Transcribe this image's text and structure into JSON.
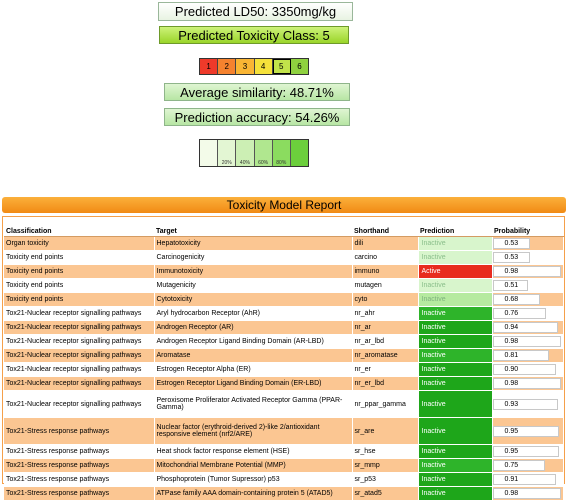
{
  "ld50": "Predicted LD50: 3350mg/kg",
  "toxicity_class": "Predicted Toxicity Class: 5",
  "class_scale": [
    {
      "label": "1",
      "color": "#ee3a2a"
    },
    {
      "label": "2",
      "color": "#f5822e"
    },
    {
      "label": "3",
      "color": "#f9b534"
    },
    {
      "label": "4",
      "color": "#f5e13a"
    },
    {
      "label": "5",
      "color": "#c2e34a"
    },
    {
      "label": "6",
      "color": "#8fd13f"
    }
  ],
  "average_similarity": "Average similarity: 48.71%",
  "prediction_accuracy": "Prediction accuracy: 54.26%",
  "accuracy_scale": [
    {
      "label": "",
      "color": "#f3fbe9"
    },
    {
      "label": "20%",
      "color": "#e3f6d3"
    },
    {
      "label": "40%",
      "color": "#ccefb4"
    },
    {
      "label": "60%",
      "color": "#b0e78f"
    },
    {
      "label": "80%",
      "color": "#8bdc5f"
    },
    {
      "label": "",
      "color": "#6ccf3c"
    }
  ],
  "report": {
    "title": "Toxicity Model Report",
    "headers": [
      "Classification",
      "Target",
      "Shorthand",
      "Prediction",
      "Probability"
    ],
    "rows": [
      {
        "classification": "Organ toxicity",
        "target": "Hepatotoxicity",
        "shorthand": "dili",
        "prediction": "Inactive",
        "probability": 0.53,
        "probability_text": "0.53",
        "pred_color": "#d8f5cc",
        "pred_text_color": "#8bbf8b"
      },
      {
        "classification": "Toxicity end points",
        "target": "Carcinogenicity",
        "shorthand": "carcino",
        "prediction": "Inactive",
        "probability": 0.53,
        "probability_text": "0.53",
        "pred_color": "#d8f5cc",
        "pred_text_color": "#8bbf8b"
      },
      {
        "classification": "Toxicity end points",
        "target": "Immunotoxicity",
        "shorthand": "immuno",
        "prediction": "Active",
        "probability": 0.98,
        "probability_text": "0.98",
        "pred_color": "#e82c1e",
        "pred_text_color": "#ffffff"
      },
      {
        "classification": "Toxicity end points",
        "target": "Mutagenicity",
        "shorthand": "mutagen",
        "prediction": "Inactive",
        "probability": 0.51,
        "probability_text": "0.51",
        "pred_color": "#d8f5cc",
        "pred_text_color": "#8bbf8b"
      },
      {
        "classification": "Toxicity end points",
        "target": "Cytotoxicity",
        "shorthand": "cyto",
        "prediction": "Inactive",
        "probability": 0.68,
        "probability_text": "0.68",
        "pred_color": "#b6eaa0",
        "pred_text_color": "#7fb37f"
      },
      {
        "classification": "Tox21-Nuclear receptor signalling pathways",
        "target": "Aryl hydrocarbon Receptor (AhR)",
        "shorthand": "nr_ahr",
        "prediction": "Inactive",
        "probability": 0.76,
        "probability_text": "0.76",
        "pred_color": "#2eb42a",
        "pred_text_color": "#ffffff"
      },
      {
        "classification": "Tox21-Nuclear receptor signalling pathways",
        "target": "Androgen Receptor (AR)",
        "shorthand": "nr_ar",
        "prediction": "Inactive",
        "probability": 0.94,
        "probability_text": "0.94",
        "pred_color": "#1ea61a",
        "pred_text_color": "#ffffff"
      },
      {
        "classification": "Tox21-Nuclear receptor signalling pathways",
        "target": "Androgen Receptor Ligand Binding Domain (AR-LBD)",
        "shorthand": "nr_ar_lbd",
        "prediction": "Inactive",
        "probability": 0.98,
        "probability_text": "0.98",
        "pred_color": "#1ea61a",
        "pred_text_color": "#ffffff"
      },
      {
        "classification": "Tox21-Nuclear receptor signalling pathways",
        "target": "Aromatase",
        "shorthand": "nr_aromatase",
        "prediction": "Inactive",
        "probability": 0.81,
        "probability_text": "0.81",
        "pred_color": "#2eb42a",
        "pred_text_color": "#ffffff"
      },
      {
        "classification": "Tox21-Nuclear receptor signalling pathways",
        "target": "Estrogen Receptor Alpha (ER)",
        "shorthand": "nr_er",
        "prediction": "Inactive",
        "probability": 0.9,
        "probability_text": "0.90",
        "pred_color": "#1ea61a",
        "pred_text_color": "#ffffff"
      },
      {
        "classification": "Tox21-Nuclear receptor signalling pathways",
        "target": "Estrogen Receptor Ligand Binding Domain (ER-LBD)",
        "shorthand": "nr_er_lbd",
        "prediction": "Inactive",
        "probability": 0.98,
        "probability_text": "0.98",
        "pred_color": "#1ea61a",
        "pred_text_color": "#ffffff"
      },
      {
        "classification": "Tox21-Nuclear receptor signalling pathways",
        "target": "Peroxisome Proliferator Activated Receptor Gamma (PPAR-Gamma)",
        "shorthand": "nr_ppar_gamma",
        "prediction": "Inactive",
        "probability": 0.93,
        "probability_text": "0.93",
        "pred_color": "#1ea61a",
        "pred_text_color": "#ffffff",
        "tall": true
      },
      {
        "classification": "Tox21-Stress response pathways",
        "target": "Nuclear factor (erythroid-derived 2)-like 2/antioxidant responsive element (nrf2/ARE)",
        "shorthand": "sr_are",
        "prediction": "Inactive",
        "probability": 0.95,
        "probability_text": "0.95",
        "pred_color": "#1ea61a",
        "pred_text_color": "#ffffff",
        "tall": true
      },
      {
        "classification": "Tox21-Stress response pathways",
        "target": "Heat shock factor response element (HSE)",
        "shorthand": "sr_hse",
        "prediction": "Inactive",
        "probability": 0.95,
        "probability_text": "0.95",
        "pred_color": "#1ea61a",
        "pred_text_color": "#ffffff"
      },
      {
        "classification": "Tox21-Stress response pathways",
        "target": "Mitochondrial Membrane Potential (MMP)",
        "shorthand": "sr_mmp",
        "prediction": "Inactive",
        "probability": 0.75,
        "probability_text": "0.75",
        "pred_color": "#2eb42a",
        "pred_text_color": "#ffffff"
      },
      {
        "classification": "Tox21-Stress response pathways",
        "target": "Phosphoprotein (Tumor Supressor) p53",
        "shorthand": "sr_p53",
        "prediction": "Inactive",
        "probability": 0.91,
        "probability_text": "0.91",
        "pred_color": "#1ea61a",
        "pred_text_color": "#ffffff"
      },
      {
        "classification": "Tox21-Stress response pathways",
        "target": "ATPase family AAA domain-containing protein 5 (ATAD5)",
        "shorthand": "sr_atad5",
        "prediction": "Inactive",
        "probability": 0.98,
        "probability_text": "0.98",
        "pred_color": "#1ea61a",
        "pred_text_color": "#ffffff"
      }
    ]
  }
}
